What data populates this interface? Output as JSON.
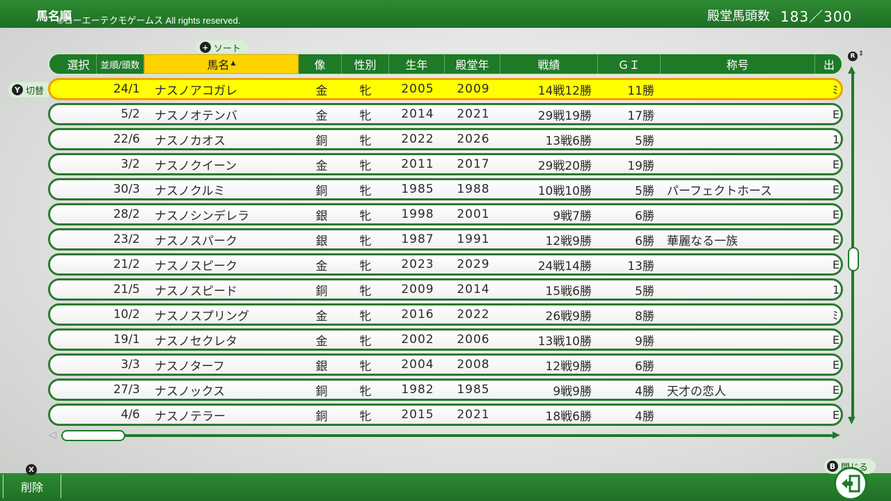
{
  "header": {
    "title": "馬名順",
    "copyright": "©コーエーテクモゲームス All rights reserved.",
    "count_label": "殿堂馬頭数",
    "count_value": "183／300"
  },
  "sort_button": {
    "key": "+",
    "label": "ソート"
  },
  "switch_button": {
    "key": "Y",
    "label": "切替"
  },
  "columns": {
    "select": "選択",
    "order": "並順/頭数",
    "name": "馬名",
    "statue": "像",
    "sex": "性別",
    "born": "生年",
    "hof_year": "殿堂年",
    "record": "戦績",
    "g1": "ＧＩ",
    "title": "称号",
    "cut": "出"
  },
  "sort_indicator": "▲",
  "rows": [
    {
      "rank": "24/1",
      "name": "ナスノアコガレ",
      "statue": "金",
      "sex": "牝",
      "born": "2005",
      "hof": "2009",
      "record": "14戦12勝",
      "g1": "11勝",
      "title": "",
      "cut": "ﾐ",
      "selected": true
    },
    {
      "rank": "5/2",
      "name": "ナスノオテンバ",
      "statue": "金",
      "sex": "牝",
      "born": "2014",
      "hof": "2021",
      "record": "29戦19勝",
      "g1": "17勝",
      "title": "",
      "cut": "E"
    },
    {
      "rank": "22/6",
      "name": "ナスノカオス",
      "statue": "銅",
      "sex": "牝",
      "born": "2022",
      "hof": "2026",
      "record": "13戦6勝",
      "g1": "5勝",
      "title": "",
      "cut": "1"
    },
    {
      "rank": "3/2",
      "name": "ナスノクイーン",
      "statue": "金",
      "sex": "牝",
      "born": "2011",
      "hof": "2017",
      "record": "29戦20勝",
      "g1": "19勝",
      "title": "",
      "cut": "E"
    },
    {
      "rank": "30/3",
      "name": "ナスノクルミ",
      "statue": "銅",
      "sex": "牝",
      "born": "1985",
      "hof": "1988",
      "record": "10戦10勝",
      "g1": "5勝",
      "title": "パーフェクトホース",
      "cut": "E"
    },
    {
      "rank": "28/2",
      "name": "ナスノシンデレラ",
      "statue": "銀",
      "sex": "牝",
      "born": "1998",
      "hof": "2001",
      "record": "9戦7勝",
      "g1": "6勝",
      "title": "",
      "cut": "E"
    },
    {
      "rank": "23/2",
      "name": "ナスノスパーク",
      "statue": "銀",
      "sex": "牝",
      "born": "1987",
      "hof": "1991",
      "record": "12戦9勝",
      "g1": "6勝",
      "title": "華麗なる一族",
      "cut": "E"
    },
    {
      "rank": "21/2",
      "name": "ナスノスピーク",
      "statue": "金",
      "sex": "牝",
      "born": "2023",
      "hof": "2029",
      "record": "24戦14勝",
      "g1": "13勝",
      "title": "",
      "cut": "E"
    },
    {
      "rank": "21/5",
      "name": "ナスノスピード",
      "statue": "銅",
      "sex": "牝",
      "born": "2009",
      "hof": "2014",
      "record": "15戦6勝",
      "g1": "5勝",
      "title": "",
      "cut": "1"
    },
    {
      "rank": "10/2",
      "name": "ナスノスプリング",
      "statue": "金",
      "sex": "牝",
      "born": "2016",
      "hof": "2022",
      "record": "26戦9勝",
      "g1": "8勝",
      "title": "",
      "cut": "ﾐ"
    },
    {
      "rank": "19/1",
      "name": "ナスノセクレタ",
      "statue": "金",
      "sex": "牝",
      "born": "2002",
      "hof": "2006",
      "record": "13戦10勝",
      "g1": "9勝",
      "title": "",
      "cut": "E"
    },
    {
      "rank": "3/3",
      "name": "ナスノターフ",
      "statue": "銀",
      "sex": "牝",
      "born": "2004",
      "hof": "2008",
      "record": "12戦9勝",
      "g1": "6勝",
      "title": "",
      "cut": "E"
    },
    {
      "rank": "27/3",
      "name": "ナスノックス",
      "statue": "銅",
      "sex": "牝",
      "born": "1982",
      "hof": "1985",
      "record": "9戦9勝",
      "g1": "4勝",
      "title": "天才の恋人",
      "cut": "E"
    },
    {
      "rank": "4/6",
      "name": "ナスノテラー",
      "statue": "銅",
      "sex": "牝",
      "born": "2015",
      "hof": "2021",
      "record": "18戦6勝",
      "g1": "4勝",
      "title": "",
      "cut": "E"
    }
  ],
  "scroll_key": "R",
  "footer": {
    "delete_key": "X",
    "delete_label": "削除",
    "close_key": "B",
    "close_label": "閉じる"
  }
}
